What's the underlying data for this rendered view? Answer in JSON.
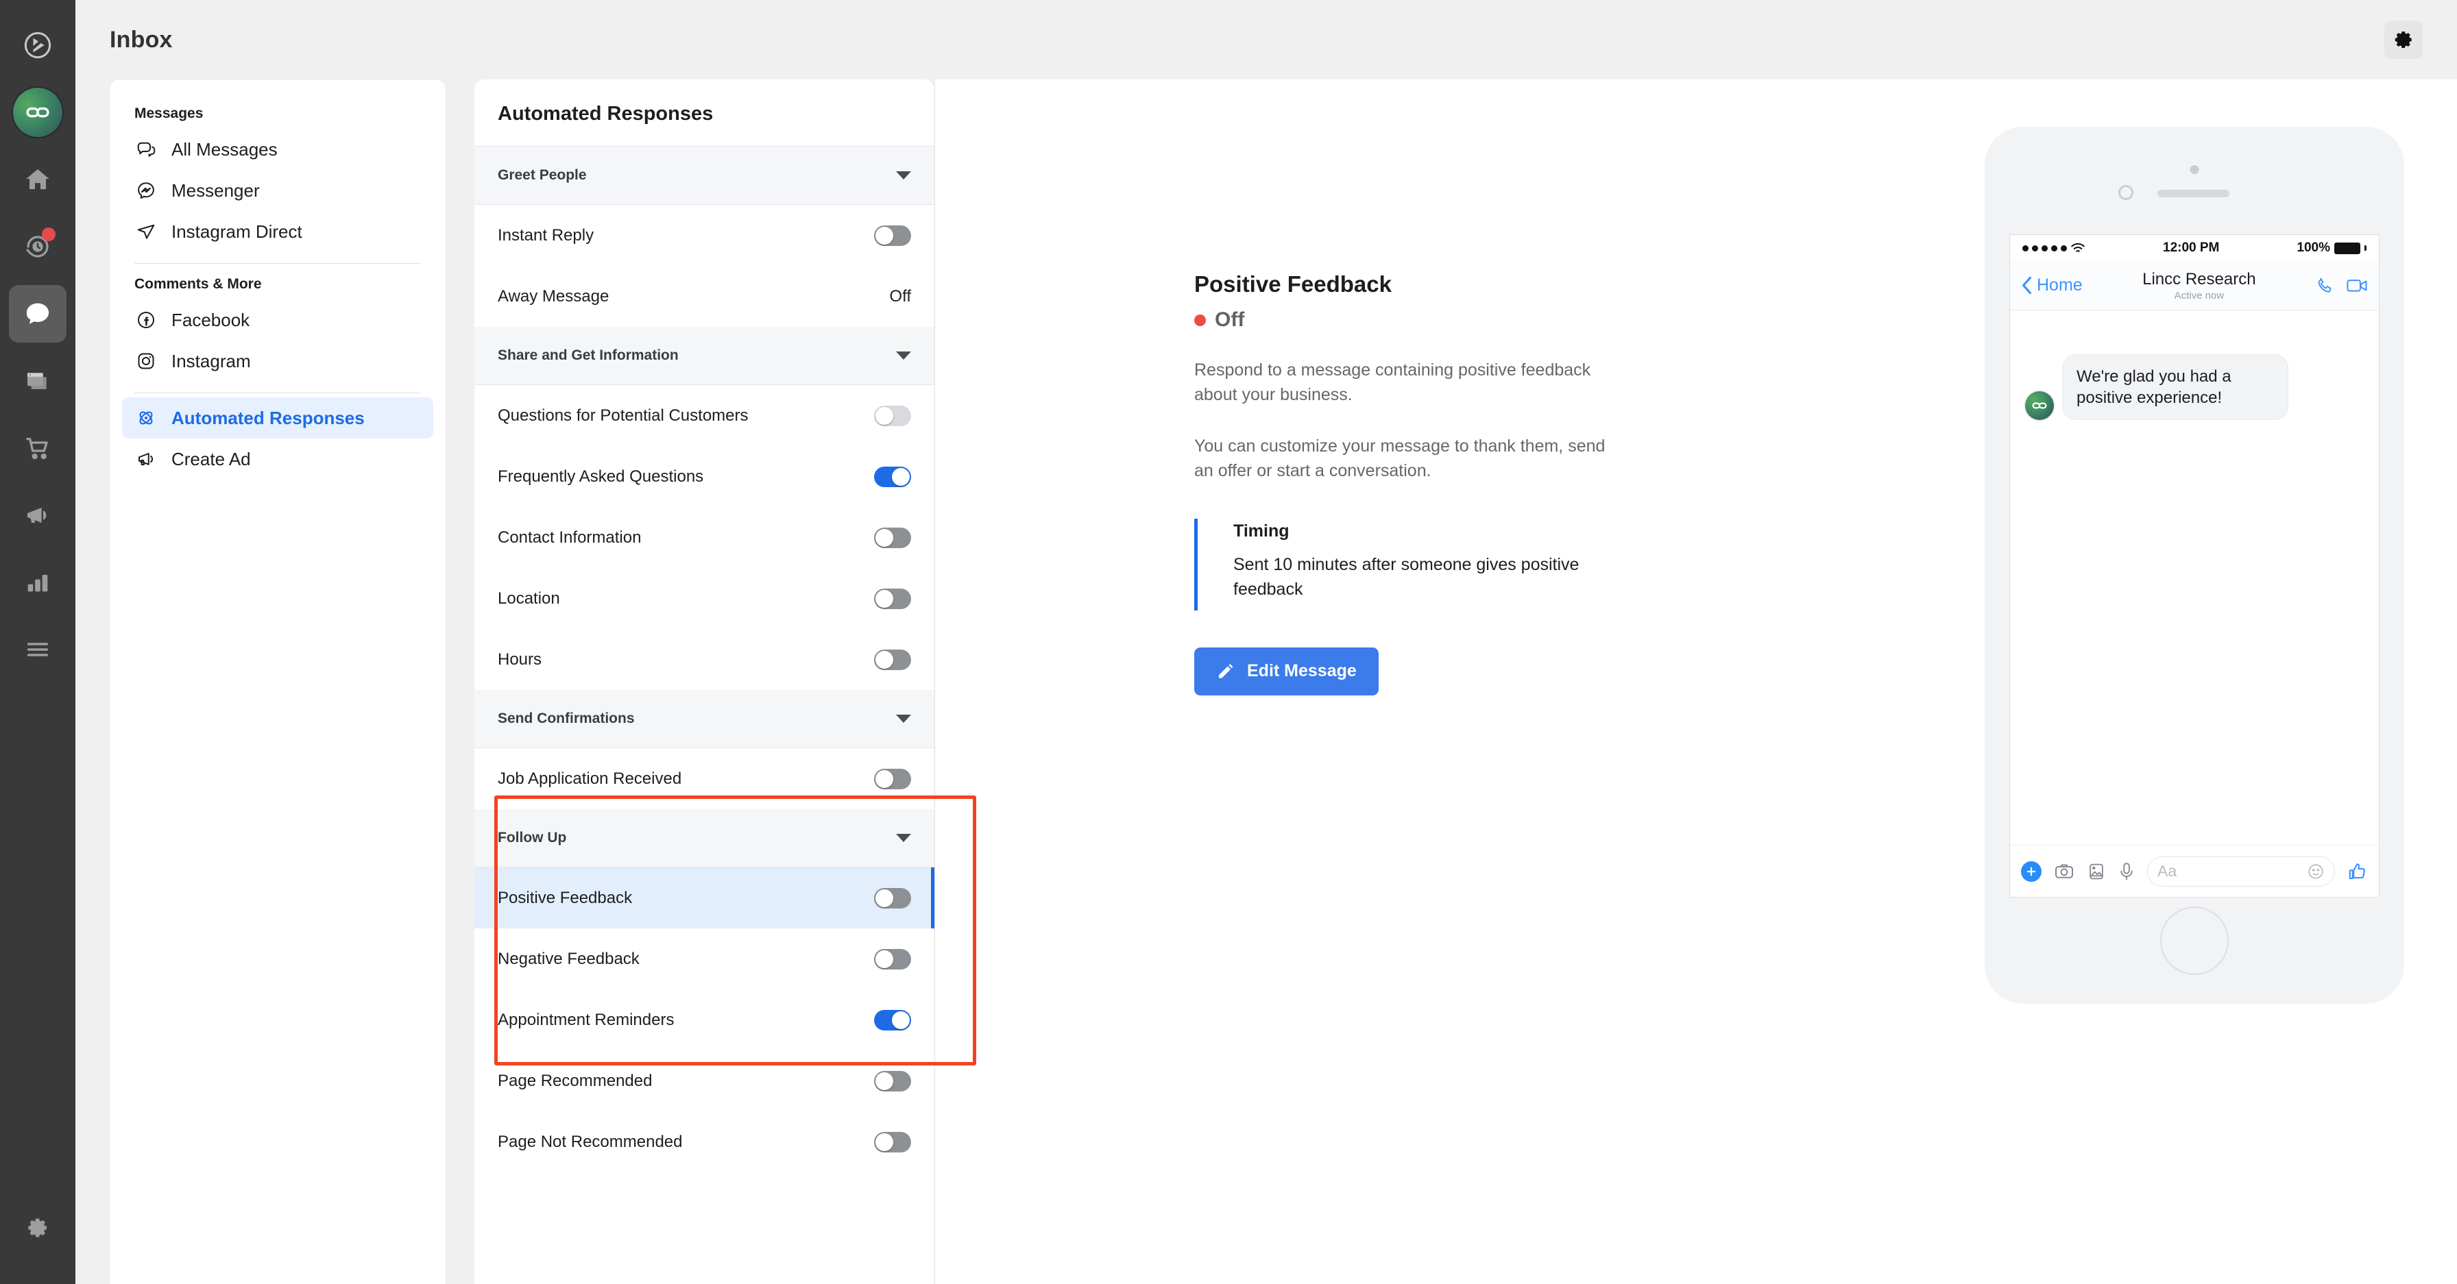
{
  "rail": {
    "items": [
      {
        "name": "logo",
        "icon": "play-circle-icon"
      },
      {
        "name": "account-avatar",
        "icon": "chain-link-icon"
      },
      {
        "name": "home",
        "icon": "home-icon"
      },
      {
        "name": "recent-activity",
        "icon": "clock-history-icon",
        "badge": true
      },
      {
        "name": "inbox",
        "icon": "chat-bubble-icon",
        "active": true
      },
      {
        "name": "pages",
        "icon": "windows-icon"
      },
      {
        "name": "commerce",
        "icon": "shopping-cart-icon"
      },
      {
        "name": "ads",
        "icon": "megaphone-icon"
      },
      {
        "name": "insights",
        "icon": "bar-chart-icon"
      },
      {
        "name": "more",
        "icon": "hamburger-icon"
      }
    ],
    "settings_icon": "gear-icon"
  },
  "topbar": {
    "title": "Inbox",
    "settings_icon": "gear-icon"
  },
  "nav": {
    "groups": [
      {
        "title": "Messages",
        "items": [
          {
            "label": "All Messages",
            "icon": "chat-bubbles-icon"
          },
          {
            "label": "Messenger",
            "icon": "messenger-icon"
          },
          {
            "label": "Instagram Direct",
            "icon": "paper-plane-icon"
          }
        ]
      },
      {
        "title": "Comments & More",
        "items": [
          {
            "label": "Facebook",
            "icon": "facebook-icon"
          },
          {
            "label": "Instagram",
            "icon": "instagram-icon"
          }
        ]
      },
      {
        "title": "",
        "items": [
          {
            "label": "Automated Responses",
            "icon": "atom-icon",
            "selected": true
          },
          {
            "label": "Create Ad",
            "icon": "megaphone-icon"
          }
        ]
      }
    ]
  },
  "automation": {
    "header": "Automated Responses",
    "sections": [
      {
        "title": "Greet People",
        "caret": "chevron-down-icon",
        "rows": [
          {
            "label": "Instant Reply",
            "control": "toggle",
            "state": "off-dark"
          },
          {
            "label": "Away Message",
            "control": "text",
            "value": "Off"
          }
        ]
      },
      {
        "title": "Share and Get Information",
        "caret": "chevron-down-icon",
        "rows": [
          {
            "label": "Questions for Potential Customers",
            "control": "toggle",
            "state": "off-light"
          },
          {
            "label": "Frequently Asked Questions",
            "control": "toggle",
            "state": "on"
          },
          {
            "label": "Contact Information",
            "control": "toggle",
            "state": "off-dark"
          },
          {
            "label": "Location",
            "control": "toggle",
            "state": "off-dark"
          },
          {
            "label": "Hours",
            "control": "toggle",
            "state": "off-dark"
          }
        ]
      },
      {
        "title": "Send Confirmations",
        "caret": "chevron-down-icon",
        "rows": [
          {
            "label": "Job Application Received",
            "control": "toggle",
            "state": "off-dark"
          }
        ]
      },
      {
        "title": "Follow Up",
        "caret": "chevron-down-icon",
        "highlighted": true,
        "rows": [
          {
            "label": "Positive Feedback",
            "control": "toggle",
            "state": "off-dark",
            "selected": true
          },
          {
            "label": "Negative Feedback",
            "control": "toggle",
            "state": "off-dark"
          },
          {
            "label": "Appointment Reminders",
            "control": "toggle",
            "state": "on"
          },
          {
            "label": "Page Recommended",
            "control": "toggle",
            "state": "off-dark"
          },
          {
            "label": "Page Not Recommended",
            "control": "toggle",
            "state": "off-dark"
          }
        ]
      }
    ]
  },
  "detail": {
    "title": "Positive Feedback",
    "status": "Off",
    "status_color": "#ed4c44",
    "paragraph1": "Respond to a message containing positive feedback about your business.",
    "paragraph2": "You can customize your message to thank them, send an offer or start a conversation.",
    "timing_title": "Timing",
    "timing_text": "Sent 10 minutes after someone gives positive feedback",
    "edit_button": "Edit Message",
    "edit_button_icon": "pencil-icon",
    "accent_color": "#3b7bea"
  },
  "phone": {
    "status": {
      "time": "12:00 PM",
      "battery": "100%",
      "wifi_icon": "wifi-icon"
    },
    "nav": {
      "back_label": "Home",
      "back_icon": "chevron-left-icon",
      "name": "Lincc Research",
      "sub": "Active now",
      "call_icon": "phone-icon",
      "video_icon": "video-camera-icon"
    },
    "message": {
      "text": "We're glad you had a positive experience!",
      "avatar_icon": "chain-link-icon"
    },
    "input": {
      "placeholder": "Aa",
      "plus_icon": "plus-icon",
      "camera_icon": "camera-icon",
      "gallery_icon": "photo-icon",
      "mic_icon": "microphone-icon",
      "emoji_icon": "smiley-icon",
      "like_icon": "thumbs-up-icon"
    }
  },
  "annotation": {
    "color": "#f4421f"
  }
}
